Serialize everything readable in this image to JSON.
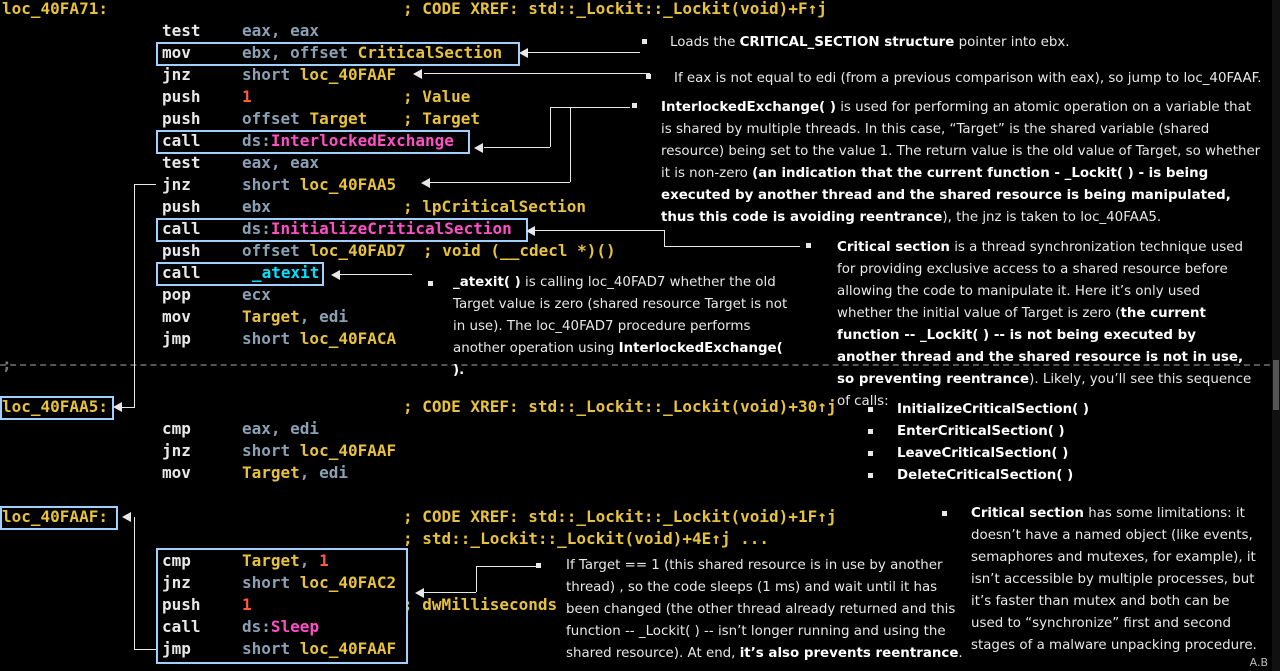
{
  "code": {
    "label_40FA71": "loc_40FA71:",
    "xref_40FA71": "; CODE XREF: std::_Lockit::_Lockit(void)+F↑j",
    "l1_mn": "test",
    "l1_op": "eax, eax",
    "l2_mn": "mov",
    "l2_op": "ebx, offset ",
    "l2_sym": "CriticalSection",
    "l3_mn": "jnz",
    "l3_op": "short ",
    "l3_sym": "loc_40FAAF",
    "l4_mn": "push",
    "l4_num": "1",
    "l4_cmt": "; Value",
    "l5_mn": "push",
    "l5_op": "offset ",
    "l5_sym": "Target",
    "l5_cmt": "; Target",
    "l6_mn": "call",
    "l6_op": "ds:",
    "l6_api": "InterlockedExchange",
    "l7_mn": "test",
    "l7_op": "eax, eax",
    "l8_mn": "jnz",
    "l8_op": "short ",
    "l8_sym": "loc_40FAA5",
    "l9_mn": "push",
    "l9_op": "ebx",
    "l9_cmt": "; lpCriticalSection",
    "l10_mn": "call",
    "l10_op": "ds:",
    "l10_api": "InitializeCriticalSection",
    "l11_mn": "push",
    "l11_op": "offset ",
    "l11_sym": "loc_40FAD7",
    "l11_cmt": "; void (__cdecl *)()",
    "l12_mn": "call",
    "l12_atex": "_atexit",
    "l13_mn": "pop",
    "l13_op": "ecx",
    "l14_mn": "mov",
    "l14_sym": "Target",
    "l14_op": ", edi",
    "l15_mn": "jmp",
    "l15_op": "short ",
    "l15_sym": "loc_40FACA",
    "sep_cmt": ";",
    "label_40FAA5": "loc_40FAA5:",
    "xref_40FAA5": "; CODE XREF: std::_Lockit::_Lockit(void)+30↑j",
    "m1_mn": "cmp",
    "m1_op": "eax, edi",
    "m2_mn": "jnz",
    "m2_op": "short ",
    "m2_sym": "loc_40FAAF",
    "m3_mn": "mov",
    "m3_sym": "Target",
    "m3_op": ", edi",
    "label_40FAAF": "loc_40FAAF:",
    "xref_40FAAF_1": "; CODE XREF: std::_Lockit::_Lockit(void)+1F↑j",
    "xref_40FAAF_2": "; std::_Lockit::_Lockit(void)+4E↑j ...",
    "n1_mn": "cmp",
    "n1_sym": "Target",
    "n1_op": ", ",
    "n1_num": "1",
    "n2_mn": "jnz",
    "n2_op": "short ",
    "n2_sym": "loc_40FAC2",
    "n3_mn": "push",
    "n3_num": "1",
    "n3_cmt": "; dwMilliseconds",
    "n4_mn": "call",
    "n4_op": "ds:",
    "n4_api": "Sleep",
    "n5_mn": "jmp",
    "n5_op": "short ",
    "n5_sym": "loc_40FAAF"
  },
  "notes": {
    "n1_a": "Loads the ",
    "n1_b": "CRITICAL_SECTION structure",
    "n1_c": " pointer into ebx.",
    "n2": "If eax is not equal to edi (from a previous comparison with eax), so jump to loc_40FAAF.",
    "n3_a": "InterlockedExchange( )",
    "n3_b": " is used for performing an atomic operation on a variable that is shared by multiple threads. In this case, “Target” is the shared variable (shared resource) being set to the value 1. The return value is the old value of Target, so whether it is non-zero ",
    "n3_c": "(an indication that the current function - _Lockit( ) - is being executed  by another thread and the shared resource is being manipulated, thus this code is avoiding reentrance",
    "n3_d": "), the jnz is taken to loc_40FAA5.",
    "n4_a": "Critical section",
    "n4_b": " is a thread synchronization technique used for providing exclusive access to a shared resource before allowing the code to manipulate it. Here it’s only used whether the initial value of Target is zero (",
    "n4_c": "the current function -- _Lockit( ) -- is not being executed by another thread and the shared resource is not in use, so preventing reentrance",
    "n4_d": "). Likely, you’ll see this sequence of calls:",
    "calls": [
      "InitializeCriticalSection( )",
      "EnterCriticalSection( )",
      "LeaveCriticalSection( )",
      "DeleteCriticalSection( )"
    ],
    "n5_a": "_atexit( )",
    "n5_b": " is calling loc_40FAD7 whether the old Target value is zero (shared resource Target is not in use). The loc_40FAD7 procedure performs another operation using ",
    "n5_c": "InterlockedExchange( ).",
    "n6_a": "Critical section",
    "n6_b": " has some limitations: it doesn’t have a named object (like events, semaphores and mutexes, for example), it isn’t accessible by multiple processes, but it’s faster than mutex and both can be used to “synchronize” first and second stages of a malware unpacking procedure.",
    "n7_a": "If Target == 1 (this shared resource is in use by another thread) , so the code sleeps (1 ms) and wait until it has been changed (the other thread already returned and this function -- _Lockit( ) -- isn’t longer running and using the shared resource). At end, ",
    "n7_b": "it’s also prevents reentrance",
    "n7_c": "."
  },
  "signature": "A.B"
}
